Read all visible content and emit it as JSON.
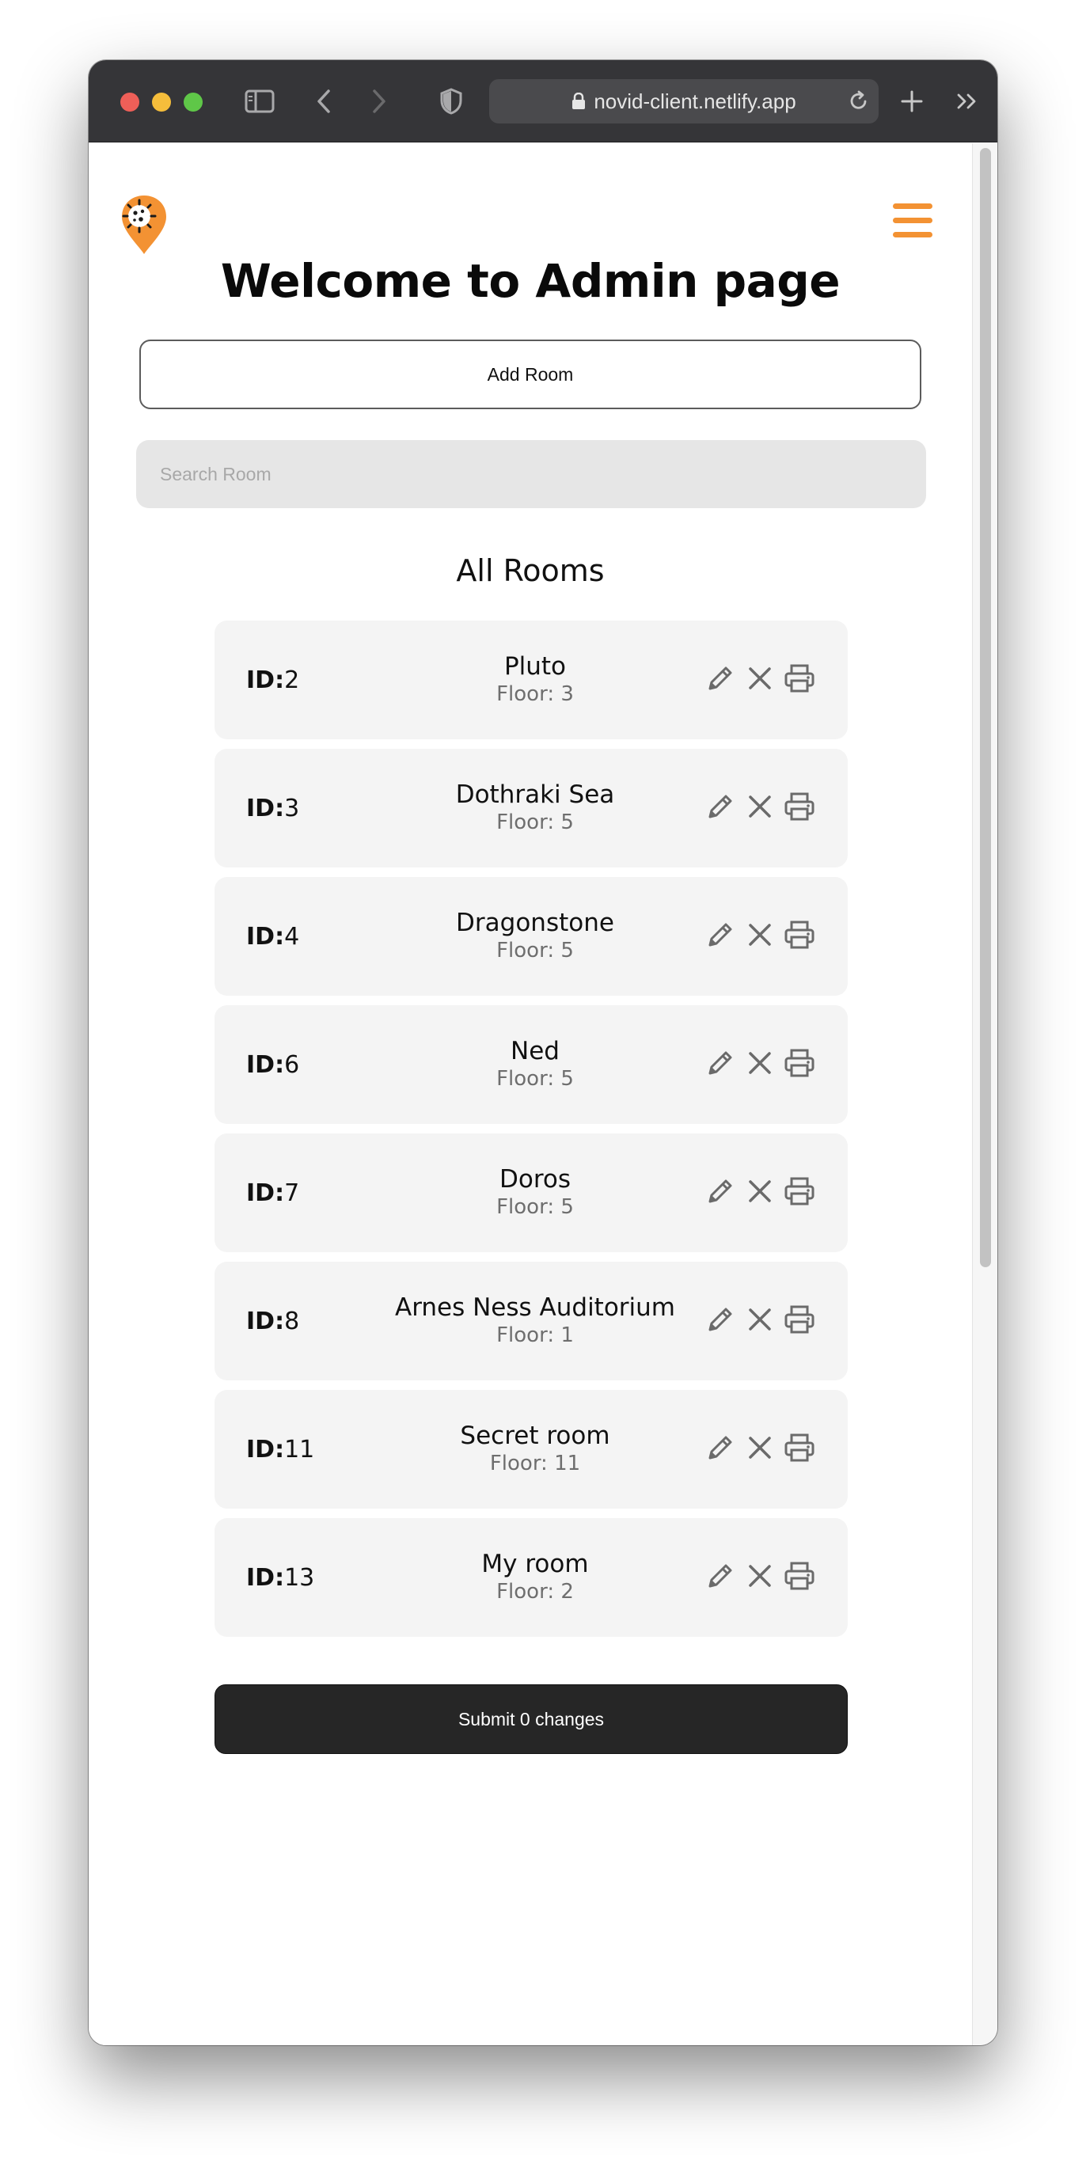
{
  "browser": {
    "url": "novid-client.netlify.app"
  },
  "page": {
    "title": "Welcome to Admin page",
    "add_room_label": "Add Room",
    "search_placeholder": "Search Room",
    "section_title": "All Rooms",
    "submit_label": "Submit 0 changes"
  },
  "colors": {
    "accent": "#f39233",
    "submit_bg": "#262626",
    "card_bg": "#f4f4f4"
  },
  "rooms": [
    {
      "id_label": "ID:",
      "id": "2",
      "name": "Pluto",
      "floor": "Floor: 3"
    },
    {
      "id_label": "ID:",
      "id": "3",
      "name": "Dothraki Sea",
      "floor": "Floor: 5"
    },
    {
      "id_label": "ID:",
      "id": "4",
      "name": "Dragonstone",
      "floor": "Floor: 5"
    },
    {
      "id_label": "ID:",
      "id": "6",
      "name": "Ned",
      "floor": "Floor: 5"
    },
    {
      "id_label": "ID:",
      "id": "7",
      "name": "Doros",
      "floor": "Floor: 5"
    },
    {
      "id_label": "ID:",
      "id": "8",
      "name": "Arnes Ness Auditorium",
      "floor": "Floor: 1"
    },
    {
      "id_label": "ID:",
      "id": "11",
      "name": "Secret room",
      "floor": "Floor: 11"
    },
    {
      "id_label": "ID:",
      "id": "13",
      "name": "My room",
      "floor": "Floor: 2"
    }
  ],
  "icons": {
    "row_actions": [
      "pencil-icon",
      "close-icon",
      "printer-icon"
    ],
    "logo": "location-pin-logo",
    "menu": "hamburger-menu-icon"
  }
}
